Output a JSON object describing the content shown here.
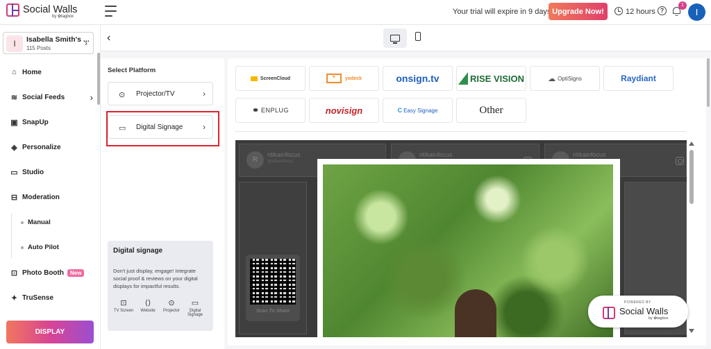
{
  "brand": {
    "name": "Social Walls",
    "by": "by ✿tagbox"
  },
  "header": {
    "trial_text": "Your trial will expire in 9 days.",
    "upgrade_label": "Upgrade Now!",
    "hours": "12 hours",
    "notification_count": "1",
    "avatar_initial": "I"
  },
  "account": {
    "initial": "I",
    "name": "Isabella Smith's ...",
    "posts": "115 Posts"
  },
  "sidebar": {
    "items": [
      {
        "label": "Home",
        "icon": "home-icon"
      },
      {
        "label": "Social Feeds",
        "icon": "layers-icon"
      },
      {
        "label": "SnapUp",
        "icon": "snapup-icon"
      },
      {
        "label": "Personalize",
        "icon": "paint-bucket-icon"
      },
      {
        "label": "Studio",
        "icon": "monitor-icon"
      },
      {
        "label": "Moderation",
        "icon": "moderation-icon"
      },
      {
        "label": "Photo Booth",
        "icon": "photo-booth-icon"
      },
      {
        "label": "TruSense",
        "icon": "sparkle-icon"
      }
    ],
    "sub_items": [
      "Manual",
      "Auto Pilot"
    ],
    "new_badge": "New",
    "display_button": "DISPLAY"
  },
  "platform_panel": {
    "title": "Select Platform",
    "options": [
      {
        "label": "Projector/TV"
      },
      {
        "label": "Digital Signage"
      }
    ],
    "card": {
      "title": "Digital signage",
      "description": "Don't just display, engage! Integrate social proof & reviews on your digital displays for impactful results.",
      "icons": [
        "TV Screen",
        "Website",
        "Projector",
        "Digital Signage"
      ]
    }
  },
  "signage_tiles": [
    "ScreenCloud",
    "yodeck",
    "onsign.tv",
    "RISE VISION",
    "OptiSigns",
    "Raydiant",
    "ENPLUG",
    "novisign",
    "Easy Signage",
    "Other"
  ],
  "wall": {
    "cards": [
      {
        "name": "ritikainfocus",
        "handle": "@ritikainfocus",
        "initial": "R"
      },
      {
        "name": "ritikainfocus",
        "handle": "",
        "initial": ""
      },
      {
        "name": "ritikainfocus",
        "handle": "",
        "initial": ""
      }
    ],
    "qr_label": "Scan To Share",
    "powered_by": "POWERED BY",
    "powered_name": "Social Walls",
    "powered_sub": "by ✿tagbox"
  }
}
